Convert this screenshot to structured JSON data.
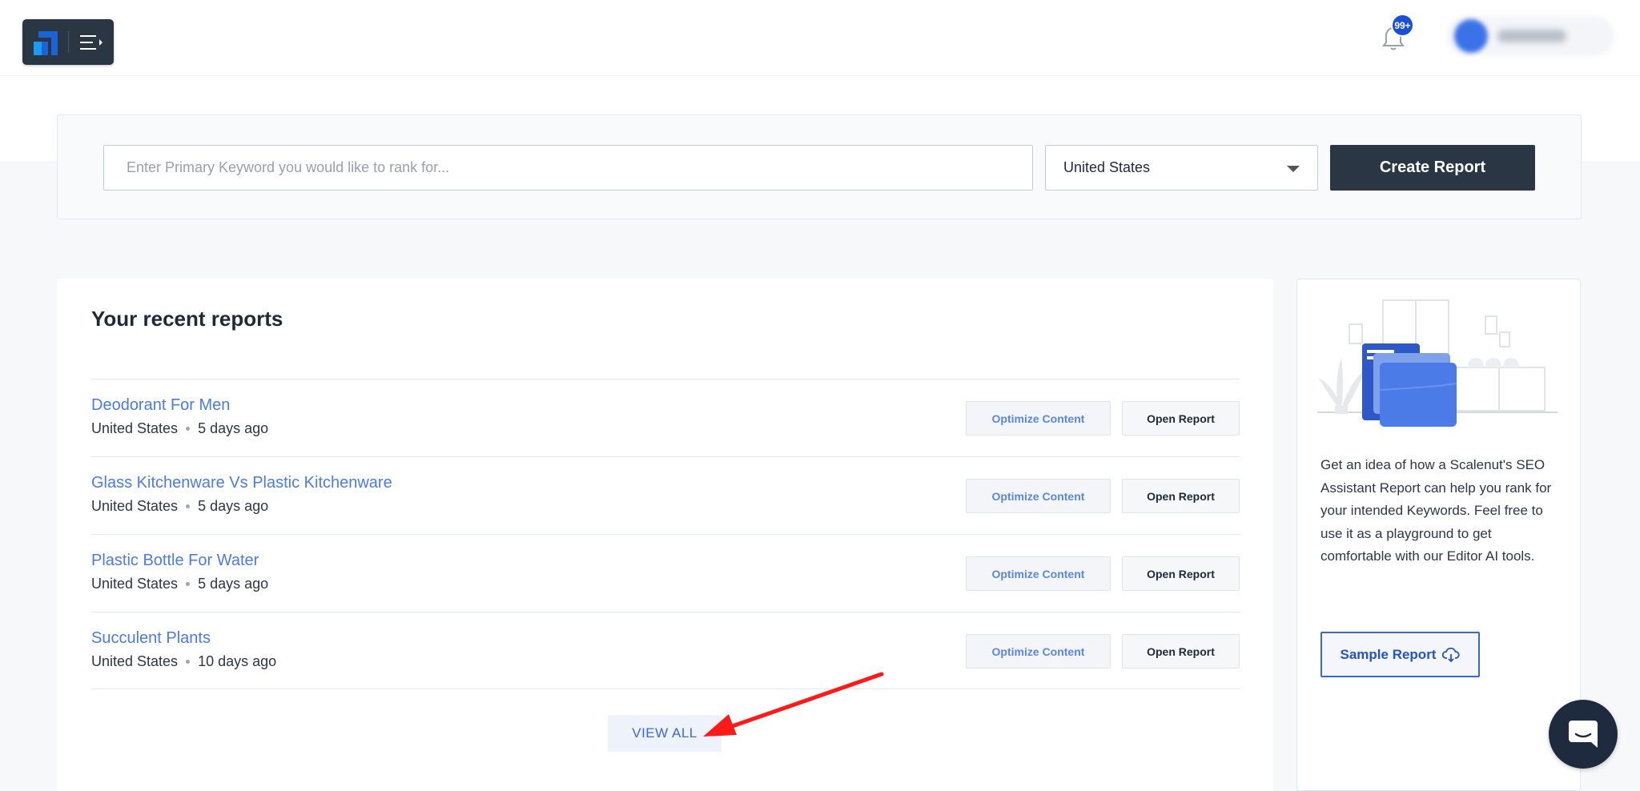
{
  "header": {
    "notification_badge": "99+"
  },
  "search": {
    "placeholder": "Enter Primary Keyword you would like to rank for...",
    "country": "United States",
    "create_label": "Create Report"
  },
  "reports": {
    "title": "Your recent reports",
    "items": [
      {
        "title": "Deodorant For Men",
        "country": "United States",
        "age": "5 days ago"
      },
      {
        "title": "Glass Kitchenware Vs Plastic Kitchenware",
        "country": "United States",
        "age": "5 days ago"
      },
      {
        "title": "Plastic Bottle For Water",
        "country": "United States",
        "age": "5 days ago"
      },
      {
        "title": "Succulent Plants",
        "country": "United States",
        "age": "10 days ago"
      }
    ],
    "optimize_label": "Optimize Content",
    "open_label": "Open Report",
    "view_all_label": "VIEW ALL"
  },
  "sample": {
    "description": "Get an idea of how a Scalenut's SEO Assistant Report can help you rank for your intended Keywords. Feel free to use it as a playground to get comfortable with our Editor AI tools.",
    "button_label": "Sample Report"
  },
  "colors": {
    "primary_dark": "#2b3645",
    "link_blue": "#4a7be6",
    "badge_blue": "#1a4fd8",
    "annotation_red": "#ff1a1a"
  }
}
